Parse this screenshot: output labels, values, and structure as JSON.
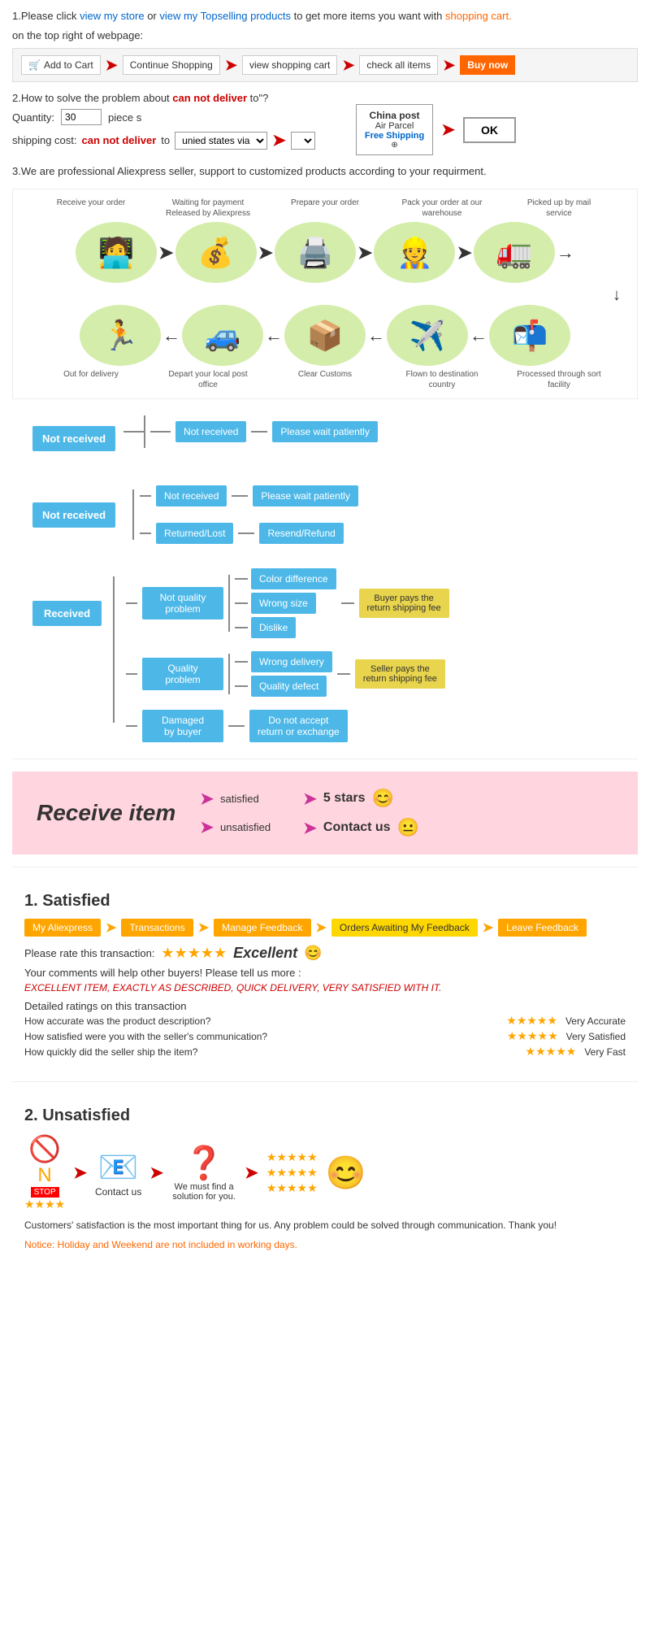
{
  "section1": {
    "text1": "1.Please click ",
    "link1": "view my store",
    "text2": "or ",
    "link2": "view my Topselling products",
    "text3": " to get more items you want with",
    "text4": "shopping cart.",
    "text5": "on the top right of webpage:",
    "buttons": [
      "Add to Cart",
      "Continue Shopping",
      "view shopping cart",
      "check all items",
      "Buy now"
    ]
  },
  "section2": {
    "text1": "2.How to solve the problem about",
    "can_not": "can not deliver",
    "text2": " to\"?",
    "qty_label": "Quantity:",
    "qty_value": "30",
    "qty_suffix": "piece s",
    "shipping_label": "shipping cost:",
    "can_not2": "can not deliver",
    "to_text": " to ",
    "via_text": "unied states via",
    "china_post_title": "China post",
    "air_parcel": "Air Parcel",
    "free_shipping": "Free Shipping",
    "ok": "OK"
  },
  "section3": {
    "text": "3.We are professional Aliexpress seller, support to customized products according to your requirment."
  },
  "process": {
    "labels_top": [
      "Receive your order",
      "Waiting for payment Released by Aliexpress",
      "Prepare your order",
      "Pack your order at our warehouse",
      "Picked up by mail service"
    ],
    "icons_top": [
      "🧑‍💻",
      "💰",
      "🖨️",
      "👷",
      "🚛"
    ],
    "labels_bottom": [
      "Out for delivery",
      "Depart your local post office",
      "Clear Customs",
      "Flown to destination country",
      "Processed through sort facility"
    ],
    "icons_bottom": [
      "🏃",
      "🚙",
      "📦",
      "✈️",
      "📬"
    ]
  },
  "flowchart": {
    "not_received_label": "Not received",
    "not_received_sub": [
      "Not received",
      "Returned/Lost"
    ],
    "not_received_outcomes": [
      "Please wait patiently",
      "Resend/Refund"
    ],
    "received_label": "Received",
    "received_subs": [
      {
        "label": "Not quality problem",
        "items": [
          "Color difference",
          "Wrong size",
          "Dislike"
        ],
        "outcome": "Buyer pays the return shipping fee"
      },
      {
        "label": "Quality problem",
        "items": [
          "Wrong delivery",
          "Quality defect"
        ],
        "outcome": "Seller pays the return shipping fee"
      },
      {
        "label": "Damaged by buyer",
        "items": [
          "Do not accept return or exchange"
        ],
        "outcome": ""
      }
    ]
  },
  "receive_item": {
    "title": "Receive item",
    "satisfied": "satisfied",
    "unsatisfied": "unsatisfied",
    "outcome1": "5 stars",
    "outcome2": "Contact us",
    "emoji1": "😊",
    "emoji2": "😐"
  },
  "satisfied": {
    "section_label": "1. Satisfied",
    "flow_steps": [
      "My Aliexpress",
      "Transactions",
      "Manage Feedback",
      "Orders Awaiting My Feedback",
      "Leave Feedback"
    ],
    "rate_text": "Please rate this transaction:",
    "excellent_text": "Excellent",
    "emoji": "😊",
    "comment_text": "Your comments will help other buyers! Please tell us more :",
    "red_text": "EXCELLENT ITEM, EXACTLY AS DESCRIBED, QUICK DELIVERY, VERY SATISFIED WITH IT.",
    "detailed_title": "Detailed ratings on this transaction",
    "ratings": [
      {
        "question": "How accurate was the product description?",
        "label": "Very Accurate"
      },
      {
        "question": "How satisfied were you with the seller's communication?",
        "label": "Very Satisfied"
      },
      {
        "question": "How quickly did the seller ship the item?",
        "label": "Very Fast"
      }
    ]
  },
  "unsatisfied": {
    "section_label": "2. Unsatisfied",
    "steps": [
      "no_icon",
      "email_icon",
      "question_icon",
      "stars_icon",
      "smiley_icon"
    ],
    "contact_label": "Contact us",
    "find_label": "We must find a solution for you.",
    "notice": "Customers' satisfaction is the most important thing for us. Any problem could be solved through communication. Thank you!",
    "notice_orange": "Notice: Holiday and Weekend are not included in working days."
  }
}
